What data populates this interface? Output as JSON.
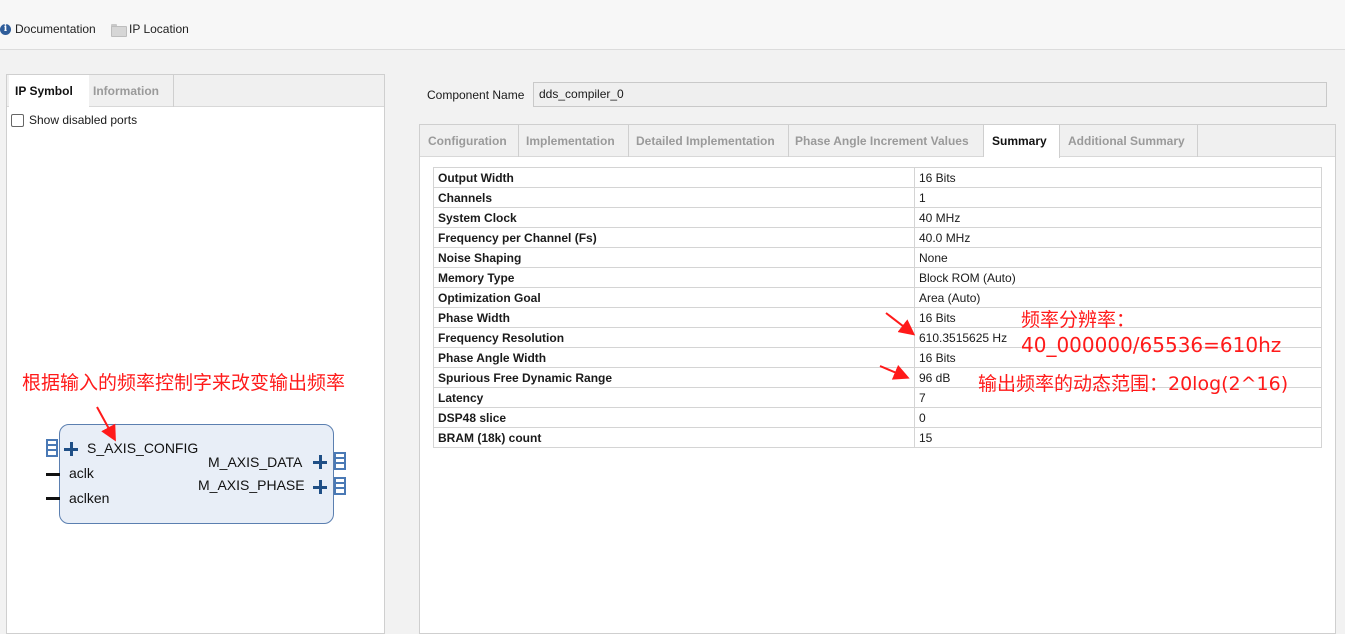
{
  "toolbar": {
    "documentation_label": "Documentation",
    "ip_location_label": "IP Location"
  },
  "left_panel": {
    "tabs": [
      "IP Symbol",
      "Information"
    ],
    "active_tab": "IP Symbol",
    "show_disabled_ports_label": "Show disabled ports",
    "show_disabled_ports_checked": false,
    "symbol": {
      "left_ports": [
        "S_AXIS_CONFIG",
        "aclk",
        "aclken"
      ],
      "right_ports": [
        "M_AXIS_DATA",
        "M_AXIS_PHASE"
      ]
    }
  },
  "component": {
    "label": "Component Name",
    "value": "dds_compiler_0"
  },
  "config_tabs": [
    "Configuration",
    "Implementation",
    "Detailed Implementation",
    "Phase Angle Increment Values",
    "Summary",
    "Additional Summary"
  ],
  "active_config_tab": "Summary",
  "summary_rows": [
    {
      "key": "Output Width",
      "value": "16 Bits"
    },
    {
      "key": "Channels",
      "value": "1"
    },
    {
      "key": "System Clock",
      "value": "40 MHz"
    },
    {
      "key": "Frequency per Channel (Fs)",
      "value": "40.0 MHz"
    },
    {
      "key": "Noise Shaping",
      "value": "None"
    },
    {
      "key": "Memory Type",
      "value": "Block ROM (Auto)"
    },
    {
      "key": "Optimization Goal",
      "value": "Area (Auto)"
    },
    {
      "key": "Phase Width",
      "value": "16 Bits"
    },
    {
      "key": "Frequency Resolution",
      "value": "610.3515625 Hz"
    },
    {
      "key": "Phase Angle Width",
      "value": "16 Bits"
    },
    {
      "key": "Spurious Free Dynamic Range",
      "value": "96 dB"
    },
    {
      "key": "Latency",
      "value": "7"
    },
    {
      "key": "DSP48 slice",
      "value": "0"
    },
    {
      "key": "BRAM (18k) count",
      "value": "15"
    }
  ],
  "annotations": {
    "input_note": "根据输入的频率控制字来改变输出频率",
    "freq_res_title": "频率分辨率：",
    "freq_res_formula": "40_000000/65536=610hz",
    "sfdr_note": "输出频率的动态范围：20log(2^16)"
  },
  "colors": {
    "annotation": "#ff1a1a",
    "symbol_fill": "#e8eef7",
    "symbol_border": "#5b7fb0",
    "port_icon": "#1f4f86"
  }
}
